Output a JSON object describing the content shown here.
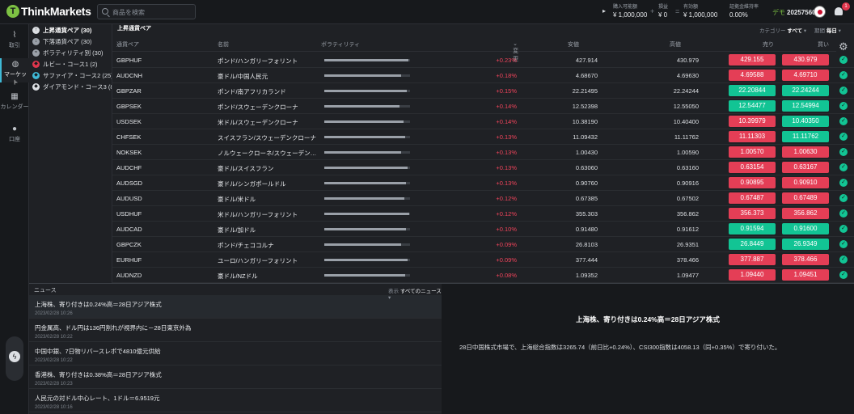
{
  "header": {
    "logo": "ThinkMarkets",
    "search_placeholder": "商品を検索",
    "account": [
      {
        "label": "購入可能額",
        "value": "¥ 1,000,000"
      },
      {
        "label": "損益",
        "value": "¥ 0"
      },
      {
        "label": "有効額",
        "value": "¥ 1,000,000"
      },
      {
        "label": "証拠金維持率",
        "value": "0.00%"
      }
    ],
    "operators": [
      "+",
      "="
    ],
    "demo_label": "デモ",
    "account_id": "20257560",
    "notification_count": "1"
  },
  "nav": [
    {
      "label": "取引",
      "icon": "chart-icon"
    },
    {
      "label": "マーケット",
      "icon": "globe-icon",
      "active": true
    },
    {
      "label": "カレンダー",
      "icon": "calendar-icon"
    },
    {
      "label": "口座",
      "icon": "user-icon"
    }
  ],
  "categories": [
    {
      "label": "上昇通貨ペア (30)",
      "icon": "arrow-up-icon",
      "color": "#dcdfe3"
    },
    {
      "label": "下落通貨ペア (30)",
      "icon": "arrow-down-icon",
      "color": "#9aa0a8"
    },
    {
      "label": "ボラティリティ別 (30)",
      "icon": "volatility-icon",
      "color": "#9aa0a8"
    },
    {
      "label": "ルビー・コース1 (2)",
      "icon": "ruby-icon",
      "color": "#e0364d"
    },
    {
      "label": "サファイア・コース2 (25)",
      "icon": "sapphire-icon",
      "color": "#3fb9d6"
    },
    {
      "label": "ダイアモンド・コース3 (8)",
      "icon": "diamond-icon",
      "color": "#dcdfe3"
    }
  ],
  "market": {
    "title": "上昇通貨ペア",
    "category_label": "カテゴリー",
    "category_value": "すべて",
    "period_label": "期間",
    "period_value": "毎日",
    "columns": {
      "symbol": "通貨ペア",
      "name": "名前",
      "volatility": "ボラティリティ",
      "change": "変更",
      "low": "安値",
      "high": "高値",
      "sell": "売り",
      "buy": "買い"
    },
    "rows": [
      {
        "symbol": "GBPHUF",
        "name": "ポンド/ハンガリーフォリント",
        "vol": 0.98,
        "change": "+0.23%",
        "low": "427.914",
        "high": "430.979",
        "sell": "429.155",
        "buy": "430.979",
        "sell_up": false,
        "buy_up": false
      },
      {
        "symbol": "AUDCNH",
        "name": "豪ドル/中国人民元",
        "vol": 0.9,
        "change": "+0.18%",
        "low": "4.68670",
        "high": "4.69630",
        "sell": "4.69588",
        "buy": "4.69710",
        "sell_up": false,
        "buy_up": false
      },
      {
        "symbol": "GBPZAR",
        "name": "ポンド/南アフリカランド",
        "vol": 0.96,
        "change": "+0.15%",
        "low": "22.21495",
        "high": "22.24244",
        "sell": "22.20844",
        "buy": "22.24244",
        "sell_up": true,
        "buy_up": true
      },
      {
        "symbol": "GBPSEK",
        "name": "ポンド/スウェーデンクローナ",
        "vol": 0.88,
        "change": "+0.14%",
        "low": "12.52398",
        "high": "12.55050",
        "sell": "12.54477",
        "buy": "12.54994",
        "sell_up": true,
        "buy_up": true
      },
      {
        "symbol": "USDSEK",
        "name": "米ドル/スウェーデンクローナ",
        "vol": 0.92,
        "change": "+0.14%",
        "low": "10.38190",
        "high": "10.40400",
        "sell": "10.39979",
        "buy": "10.40350",
        "sell_up": false,
        "buy_up": true
      },
      {
        "symbol": "CHFSEK",
        "name": "スイスフラン/スウェーデンクローナ",
        "vol": 0.94,
        "change": "+0.13%",
        "low": "11.09432",
        "high": "11.11762",
        "sell": "11.11303",
        "buy": "11.11762",
        "sell_up": false,
        "buy_up": true
      },
      {
        "symbol": "NOKSEK",
        "name": "ノルウェークローネ/スウェーデン…",
        "vol": 0.9,
        "change": "+0.13%",
        "low": "1.00430",
        "high": "1.00590",
        "sell": "1.00570",
        "buy": "1.00630",
        "sell_up": false,
        "buy_up": false
      },
      {
        "symbol": "AUDCHF",
        "name": "豪ドル/スイスフラン",
        "vol": 0.97,
        "change": "+0.13%",
        "low": "0.63060",
        "high": "0.63160",
        "sell": "0.63154",
        "buy": "0.63167",
        "sell_up": false,
        "buy_up": false
      },
      {
        "symbol": "AUDSGD",
        "name": "豪ドル/シンガポールドル",
        "vol": 0.95,
        "change": "+0.13%",
        "low": "0.90760",
        "high": "0.90916",
        "sell": "0.90895",
        "buy": "0.90910",
        "sell_up": false,
        "buy_up": false
      },
      {
        "symbol": "AUDUSD",
        "name": "豪ドル/米ドル",
        "vol": 0.93,
        "change": "+0.12%",
        "low": "0.67385",
        "high": "0.67502",
        "sell": "0.67487",
        "buy": "0.67489",
        "sell_up": false,
        "buy_up": false
      },
      {
        "symbol": "USDHUF",
        "name": "米ドル/ハンガリーフォリント",
        "vol": 0.99,
        "change": "+0.12%",
        "low": "355.303",
        "high": "356.862",
        "sell": "356.373",
        "buy": "356.862",
        "sell_up": false,
        "buy_up": false
      },
      {
        "symbol": "AUDCAD",
        "name": "豪ドル/加ドル",
        "vol": 0.95,
        "change": "+0.10%",
        "low": "0.91480",
        "high": "0.91612",
        "sell": "0.91594",
        "buy": "0.91600",
        "sell_up": true,
        "buy_up": true
      },
      {
        "symbol": "GBPCZK",
        "name": "ポンド/チェココルナ",
        "vol": 0.9,
        "change": "+0.09%",
        "low": "26.8103",
        "high": "26.9351",
        "sell": "26.8449",
        "buy": "26.9349",
        "sell_up": true,
        "buy_up": true
      },
      {
        "symbol": "EURHUF",
        "name": "ユーロ/ハンガリーフォリント",
        "vol": 0.97,
        "change": "+0.09%",
        "low": "377.444",
        "high": "378.466",
        "sell": "377.887",
        "buy": "378.466",
        "sell_up": false,
        "buy_up": false
      },
      {
        "symbol": "AUDNZD",
        "name": "豪ドル/NZドル",
        "vol": 0.94,
        "change": "+0.08%",
        "low": "1.09352",
        "high": "1.09477",
        "sell": "1.09440",
        "buy": "1.09451",
        "sell_up": false,
        "buy_up": false
      }
    ]
  },
  "news": {
    "title": "ニュース",
    "filter_label": "表示",
    "filter_value": "すべてのニュース",
    "items": [
      {
        "title": "上海株、寄り付きは0.24%高＝28日アジア株式",
        "date": "2023/02/28 10:26"
      },
      {
        "title": "円金属高、ドル円は136円割れが視界内に－28日東京外為",
        "date": "2023/02/28 10:22"
      },
      {
        "title": "中国中銀、7日物リバースレポで4810億元供給",
        "date": "2023/02/28 10:22"
      },
      {
        "title": "香港株、寄り付きは0.38%高＝28日アジア株式",
        "date": "2023/02/28 10:23"
      },
      {
        "title": "人民元の対ドル中心レート、1ドル＝6.9519元",
        "date": "2023/02/28 10:16"
      }
    ]
  },
  "detail": {
    "title": "上海株、寄り付きは0.24%高＝28日アジア株式",
    "body": "28日中国株式市場で、上海総合指数は3265.74（前日比+0.24%）、CSI300指数は4058.13（同+0.35%）で寄り付いた。"
  }
}
